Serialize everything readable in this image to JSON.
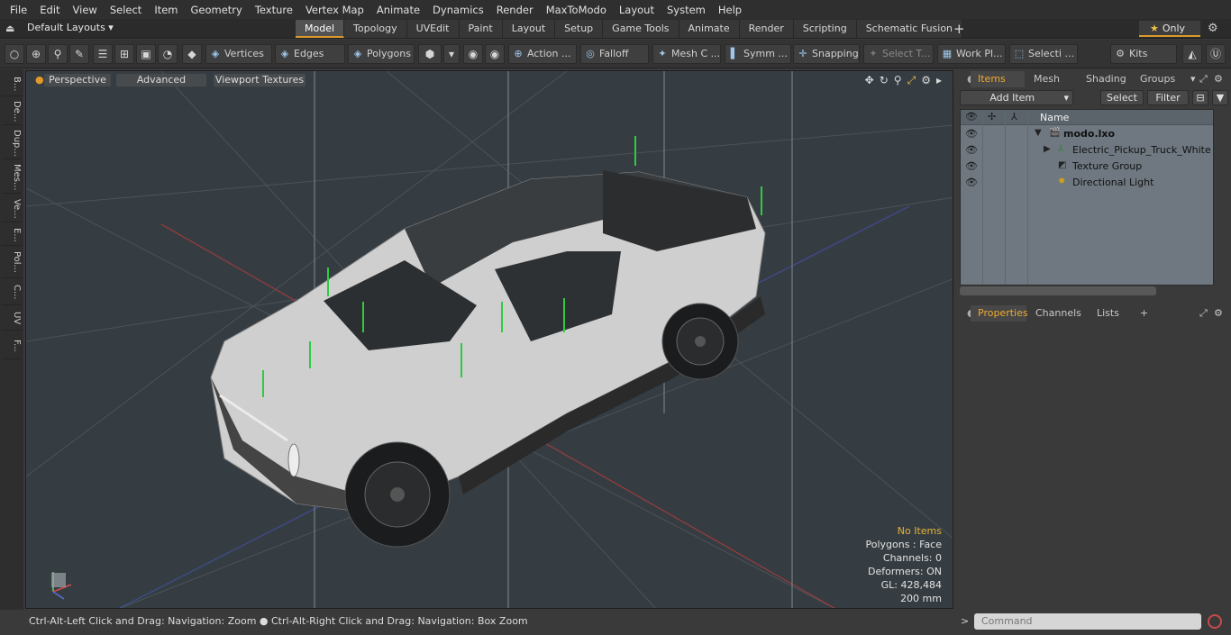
{
  "menu": [
    "File",
    "Edit",
    "View",
    "Select",
    "Item",
    "Geometry",
    "Texture",
    "Vertex Map",
    "Animate",
    "Dynamics",
    "Render",
    "MaxToModo",
    "Layout",
    "System",
    "Help"
  ],
  "layout": {
    "default_layouts": "Default Layouts ▾",
    "tabs": [
      "Model",
      "Topology",
      "UVEdit",
      "Paint",
      "Layout",
      "Setup",
      "Game Tools",
      "Animate",
      "Render",
      "Scripting",
      "Schematic Fusion"
    ],
    "active_tab": "Model",
    "only_label": "Only"
  },
  "toolbar": {
    "vertices": "Vertices",
    "edges": "Edges",
    "polygons": "Polygons",
    "action": "Action ...",
    "falloff": "Falloff",
    "mesh": "Mesh C ...",
    "symm": "Symm ...",
    "snapping": "Snapping",
    "select_t": "Select T...",
    "work_pl": "Work Pl...",
    "selecti": "Selecti ...",
    "kits": "Kits"
  },
  "left_tabs": [
    "B...",
    "De...",
    "Dup...",
    "Mes...",
    "Ve...",
    "E...",
    "Pol...",
    "C...",
    "UV",
    "F..."
  ],
  "viewport": {
    "perspective": "Perspective",
    "advanced": "Advanced",
    "viewport_textures": "Viewport Textures",
    "hud": {
      "no_items": "No Items",
      "polygons": "Polygons : Face",
      "channels": "Channels: 0",
      "deformers": "Deformers: ON",
      "gl": "GL: 428,484",
      "scale": "200 mm"
    }
  },
  "items_panel": {
    "tabs": [
      "Items",
      "Mesh ...",
      "Shading",
      "Groups"
    ],
    "add_item": "Add Item",
    "select": "Select",
    "filter": "Filter",
    "name_header": "Name",
    "rows": [
      {
        "label": "modo.lxo"
      },
      {
        "label": "Electric_Pickup_Truck_White"
      },
      {
        "label": "Texture Group"
      },
      {
        "label": "Directional Light"
      }
    ]
  },
  "properties_panel": {
    "tabs": [
      "Properties",
      "Channels",
      "Lists"
    ]
  },
  "status": {
    "hint": "Ctrl-Alt-Left Click and Drag: Navigation: Zoom ● Ctrl-Alt-Right Click and Drag: Navigation: Box Zoom",
    "command_placeholder": "Command"
  },
  "colors": {
    "accent": "#d99a2b",
    "viewport_bg": "#363d42",
    "tree_bg": "#6f7880"
  }
}
